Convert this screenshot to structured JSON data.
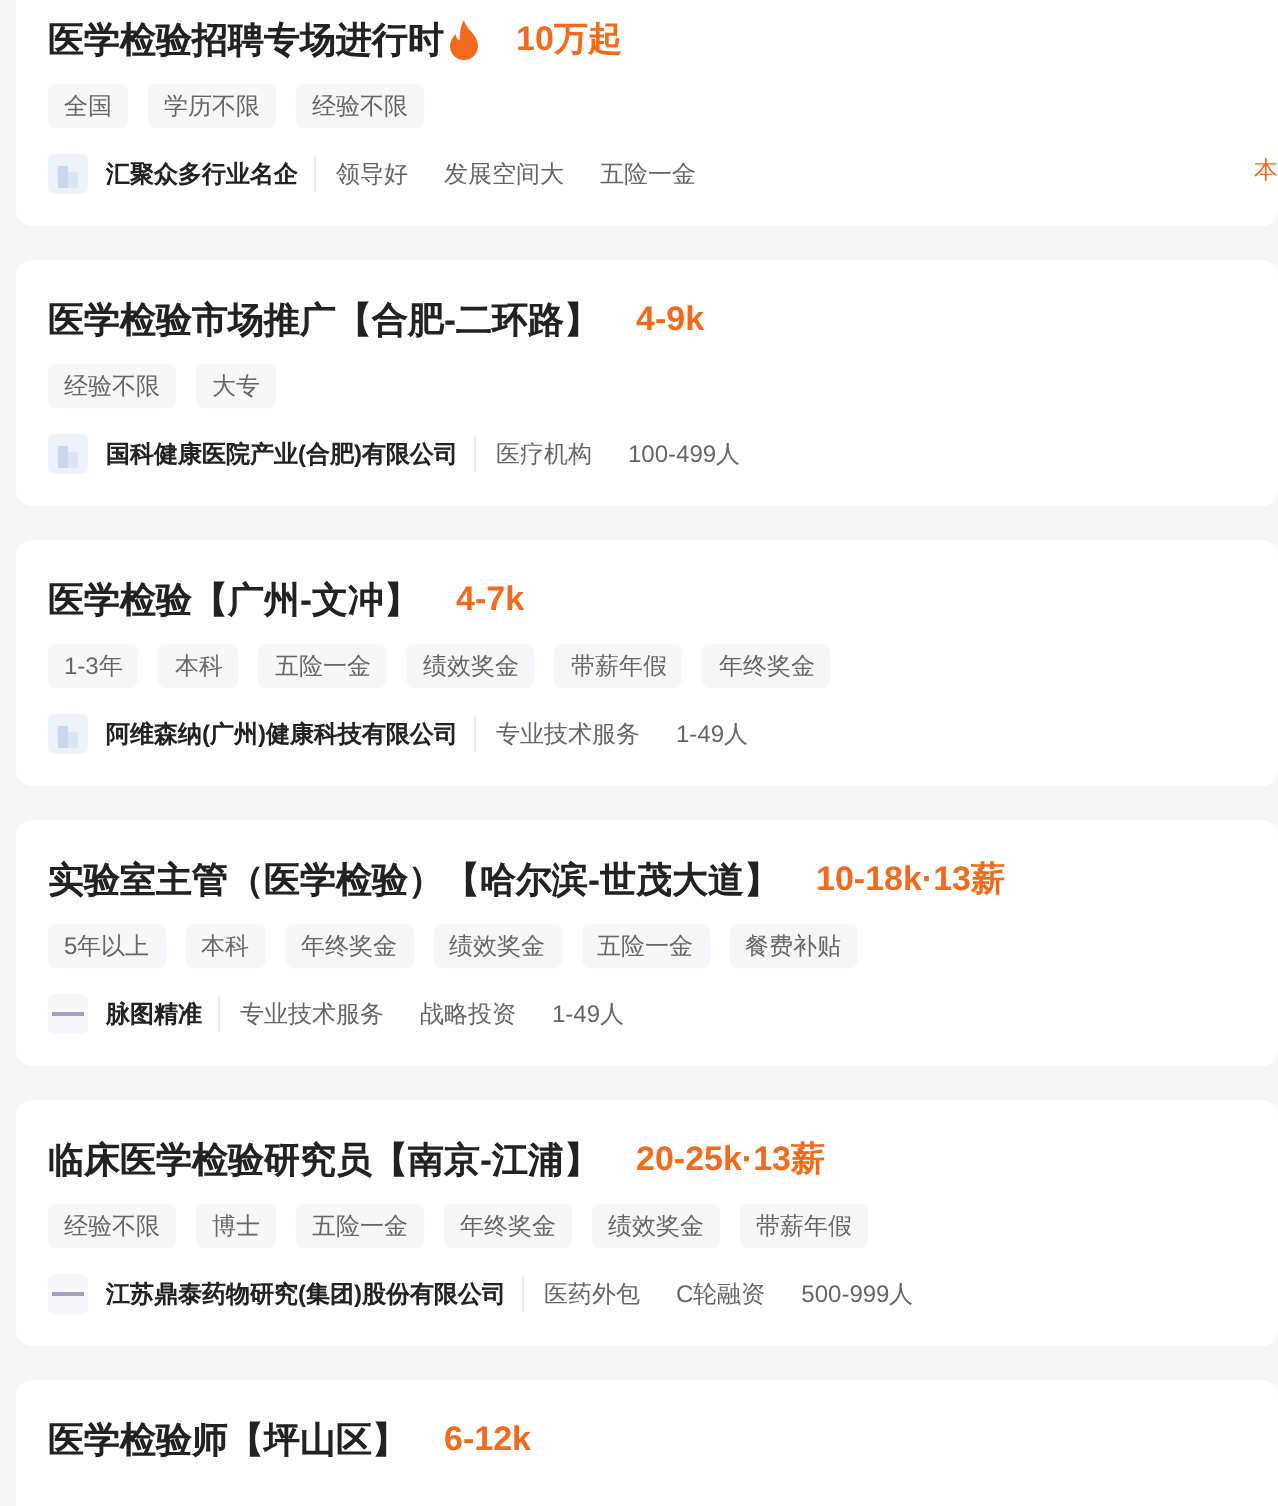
{
  "jobs": [
    {
      "title": "医学检验招聘专场进行时",
      "hot": true,
      "salary": "10万起",
      "tags": [
        "全国",
        "学历不限",
        "经验不限"
      ],
      "logo": {
        "kind": "building"
      },
      "company": "汇聚众多行业名企",
      "details": [
        "领导好",
        "发展空间大",
        "五险一金"
      ],
      "side_note": "本"
    },
    {
      "title": "医学检验市场推广【合肥-二环路】",
      "hot": false,
      "salary": "4-9k",
      "tags": [
        "经验不限",
        "大专"
      ],
      "logo": {
        "kind": "building"
      },
      "company": "国科健康医院产业(合肥)有限公司",
      "details": [
        "医疗机构",
        "100-499人"
      ]
    },
    {
      "title": "医学检验【广州-文冲】",
      "hot": false,
      "salary": "4-7k",
      "tags": [
        "1-3年",
        "本科",
        "五险一金",
        "绩效奖金",
        "带薪年假",
        "年终奖金"
      ],
      "logo": {
        "kind": "building"
      },
      "company": "阿维森纳(广州)健康科技有限公司",
      "details": [
        "专业技术服务",
        "1-49人"
      ]
    },
    {
      "title": "实验室主管（医学检验）【哈尔滨-世茂大道】",
      "hot": false,
      "salary": "10-18k·13薪",
      "tags": [
        "5年以上",
        "本科",
        "年终奖金",
        "绩效奖金",
        "五险一金",
        "餐费补贴"
      ],
      "logo": {
        "kind": "wordmark"
      },
      "company": "脉图精准",
      "details": [
        "专业技术服务",
        "战略投资",
        "1-49人"
      ]
    },
    {
      "title": "临床医学检验研究员【南京-江浦】",
      "hot": false,
      "salary": "20-25k·13薪",
      "tags": [
        "经验不限",
        "博士",
        "五险一金",
        "年终奖金",
        "绩效奖金",
        "带薪年假"
      ],
      "logo": {
        "kind": "wordmark"
      },
      "company": "江苏鼎泰药物研究(集团)股份有限公司",
      "details": [
        "医药外包",
        "C轮融资",
        "500-999人"
      ]
    },
    {
      "title": "医学检验师【坪山区】",
      "hot": false,
      "salary": "6-12k"
    }
  ]
}
